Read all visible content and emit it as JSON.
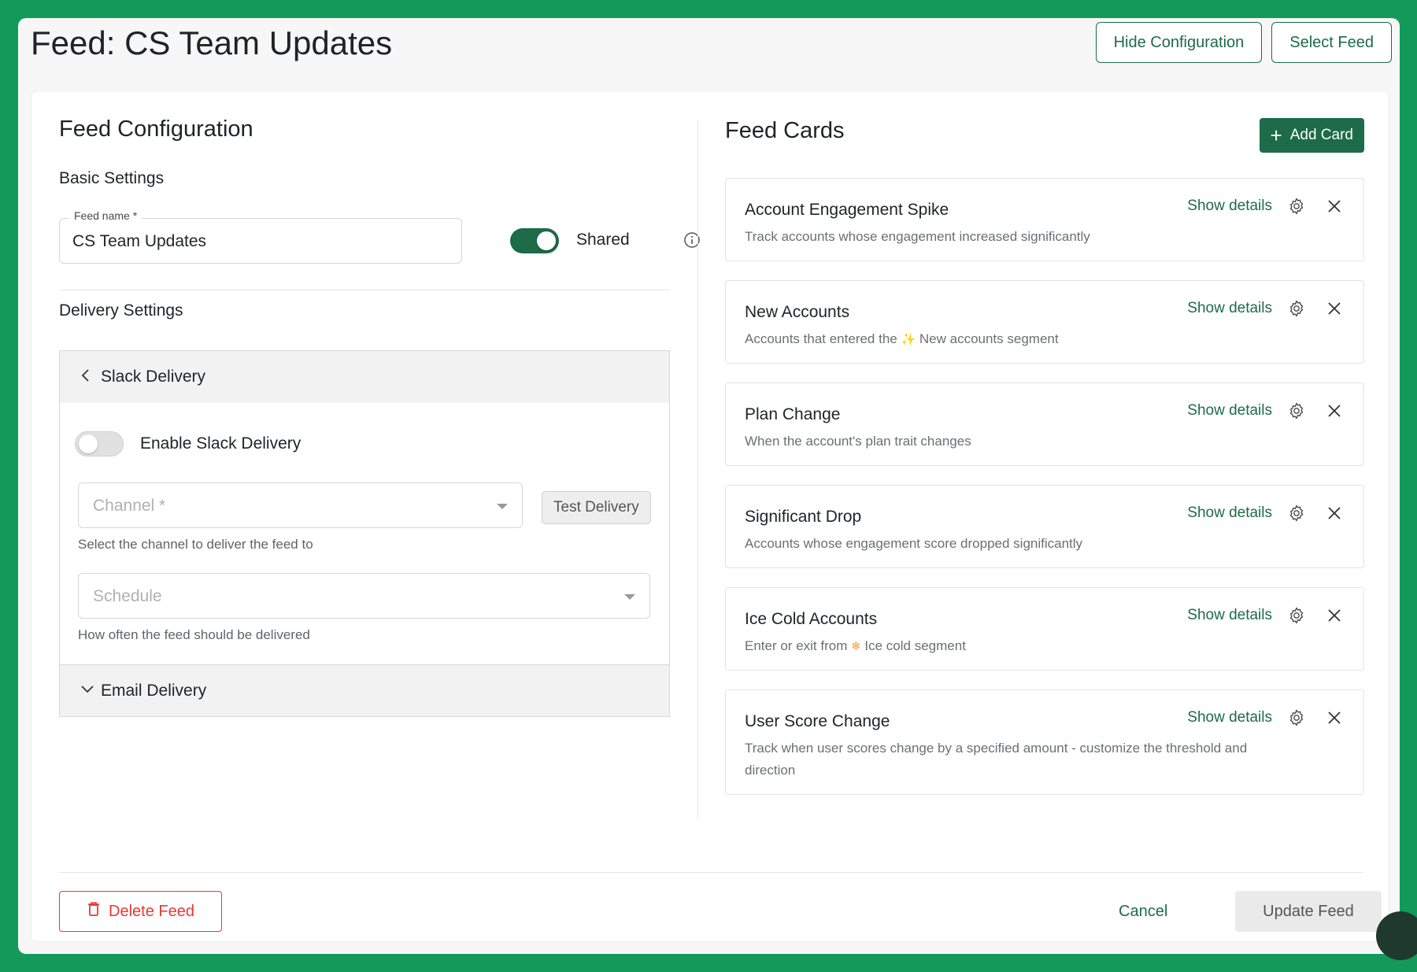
{
  "header": {
    "title": "Feed: CS Team Updates",
    "hide_config_label": "Hide Configuration",
    "select_feed_label": "Select Feed"
  },
  "config": {
    "title": "Feed Configuration",
    "basic_settings": "Basic Settings",
    "feed_name_label": "Feed name *",
    "feed_name_value": "CS Team Updates",
    "shared_label": "Shared",
    "shared_on": true,
    "delivery_settings": "Delivery Settings",
    "slack": {
      "title": "Slack Delivery",
      "enable_label": "Enable Slack Delivery",
      "enabled": false,
      "channel_placeholder": "Channel *",
      "channel_helper": "Select the channel to deliver the feed to",
      "test_label": "Test Delivery",
      "schedule_placeholder": "Schedule",
      "schedule_helper": "How often the feed should be delivered"
    },
    "email": {
      "title": "Email Delivery"
    }
  },
  "cards": {
    "title": "Feed Cards",
    "add_label": "Add Card",
    "show_details_label": "Show details",
    "items": [
      {
        "title": "Account Engagement Spike",
        "desc": "Track accounts whose engagement increased significantly"
      },
      {
        "title": "New Accounts",
        "desc_pre": "Accounts that entered the ",
        "desc_icon": "✨",
        "desc_post": " New accounts segment"
      },
      {
        "title": "Plan Change",
        "desc": "When the account's plan trait changes"
      },
      {
        "title": "Significant Drop",
        "desc": "Accounts whose engagement score dropped significantly"
      },
      {
        "title": "Ice Cold Accounts",
        "desc_pre": "Enter or exit from ",
        "desc_icon": "❄",
        "desc_post": " Ice cold segment"
      },
      {
        "title": "User Score Change",
        "desc": "Track when user scores change by a specified amount - customize the threshold and direction"
      }
    ]
  },
  "footer": {
    "delete_label": "Delete Feed",
    "cancel_label": "Cancel",
    "update_label": "Update Feed"
  },
  "colors": {
    "brand_green": "#1d6b48",
    "frame_green": "#139a5a",
    "danger": "#e53935"
  }
}
